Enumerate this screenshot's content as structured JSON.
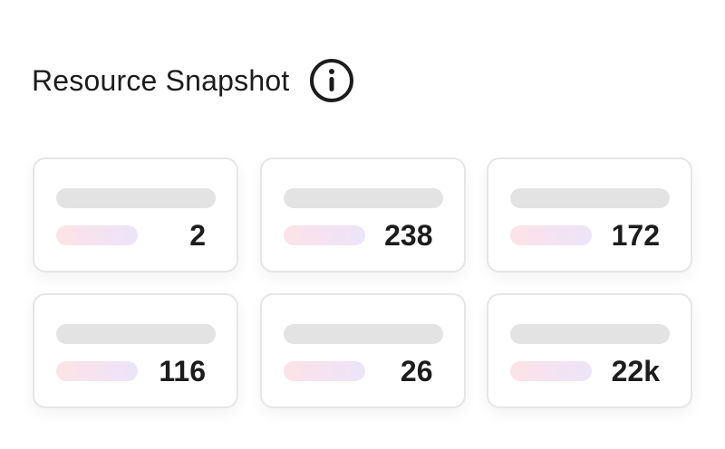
{
  "header": {
    "title": "Resource Snapshot",
    "info_icon": "info-icon"
  },
  "cards": [
    {
      "value": "2"
    },
    {
      "value": "238"
    },
    {
      "value": "172"
    },
    {
      "value": "116"
    },
    {
      "value": "26"
    },
    {
      "value": "22k"
    }
  ],
  "colors": {
    "text": "#1c1c1c",
    "card_border": "#e6e6e6",
    "skeleton": "#e3e3e3",
    "accent_gradient_start": "#fde3e6",
    "accent_gradient_end": "#ece4fa"
  }
}
